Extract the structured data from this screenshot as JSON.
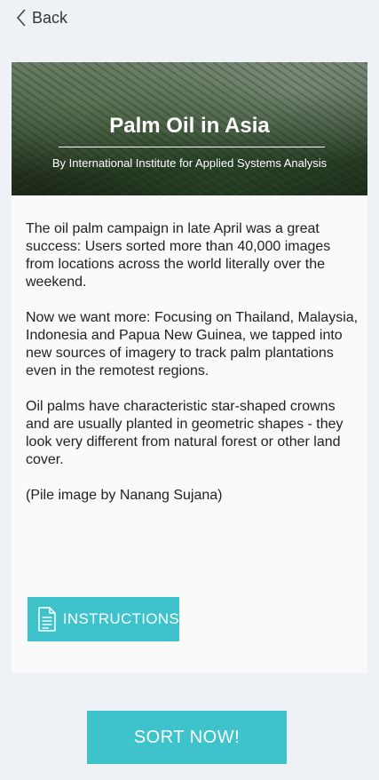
{
  "nav": {
    "back_label": "Back",
    "back_icon": "chevron-left-icon"
  },
  "project": {
    "title": "Palm Oil in Asia",
    "subtitle": "By International Institute for Applied Systems Analysis",
    "hero_image": "aerial-palm-plantation-image",
    "paragraphs": [
      "The oil palm campaign in late April was a great success: Users sorted more than 40,000 images from locations across the world literally over the weekend.",
      "Now we want more: Focusing on Thailand, Malaysia, Indonesia and Papua New Guinea, we tapped into new sources of imagery to track palm plantations even in the remotest regions.",
      "Oil palms have characteristic star-shaped crowns and are usually planted in geometric shapes - they look very different from natural forest or other land cover.",
      "(Pile image by Nanang Sujana)"
    ]
  },
  "actions": {
    "instructions_label": "INSTRUCTIONS",
    "instructions_icon": "document-icon",
    "sort_label": "SORT NOW!"
  },
  "colors": {
    "accent": "#3ec3cc",
    "background": "#eef2f6",
    "card": "#fafafa"
  }
}
